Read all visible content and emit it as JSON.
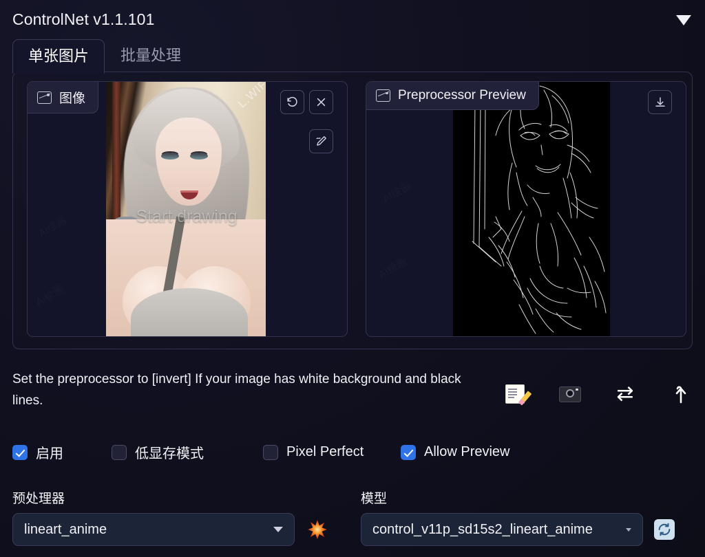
{
  "header": {
    "title": "ControlNet v1.1.101",
    "collapse_icon": "chevron-down-icon"
  },
  "tabs": [
    {
      "label": "单张图片",
      "active": true
    },
    {
      "label": "批量处理",
      "active": false
    }
  ],
  "panes": {
    "image": {
      "label": "图像",
      "label_icon": "image-icon",
      "watermark": "Start drawing",
      "corner_watermark": "L.WIF",
      "tools": [
        {
          "name": "undo-button",
          "icon": "undo-icon"
        },
        {
          "name": "clear-image-button",
          "icon": "close-icon"
        },
        {
          "name": "draw-tool-button",
          "icon": "pen-icon"
        }
      ]
    },
    "preview": {
      "label": "Preprocessor Preview",
      "label_icon": "image-icon",
      "tools": [
        {
          "name": "download-button",
          "icon": "download-icon"
        }
      ]
    }
  },
  "hint": {
    "text": "Set the preprocessor to [invert] If your image has white background and black lines."
  },
  "action_icons": [
    {
      "name": "open-new-canvas-button",
      "icon": "memo-icon"
    },
    {
      "name": "webcam-button",
      "icon": "camera-icon"
    },
    {
      "name": "swap-images-button",
      "icon": "swap-icon",
      "glyph": "⇄"
    },
    {
      "name": "send-dimensions-button",
      "icon": "up-arrow-icon",
      "glyph": "⬆"
    }
  ],
  "checkboxes": [
    {
      "label": "启用",
      "checked": true
    },
    {
      "label": "低显存模式",
      "checked": false
    },
    {
      "label": "Pixel Perfect",
      "checked": false
    },
    {
      "label": "Allow Preview",
      "checked": true
    }
  ],
  "fields": {
    "preprocessor": {
      "label": "预处理器",
      "value": "lineart_anime",
      "run_icon": "burst-icon"
    },
    "model": {
      "label": "模型",
      "value": "control_v11p_sd15s2_lineart_anime",
      "refresh_icon": "refresh-icon"
    }
  },
  "colors": {
    "accent_blue": "#2f73e8",
    "background": "#0f0f1a",
    "panel": "#13132a",
    "border": "#33334d",
    "text": "#f2f2f7",
    "muted_text": "#9a9aae",
    "burst_orange": "#f06a1e",
    "refresh_bg": "#cfe0ef"
  }
}
